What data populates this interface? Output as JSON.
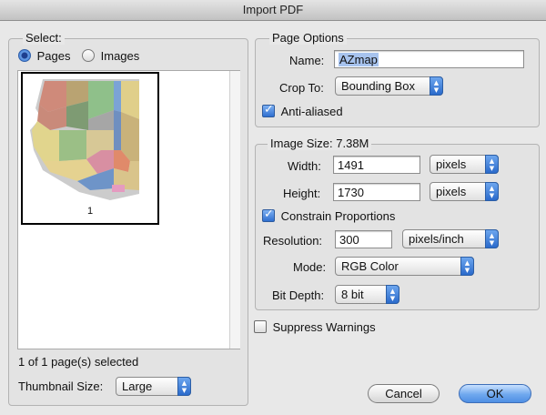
{
  "window": {
    "title": "Import PDF"
  },
  "select": {
    "legend": "Select:",
    "pages_label": "Pages",
    "images_label": "Images",
    "selected": "Pages",
    "thumbnail_page_number": "1",
    "status": "1 of 1 page(s) selected",
    "thumbnail_size_label": "Thumbnail Size:",
    "thumbnail_size_value": "Large"
  },
  "page_options": {
    "legend": "Page Options",
    "name_label": "Name:",
    "name_value": "AZmap",
    "crop_label": "Crop To:",
    "crop_value": "Bounding Box",
    "anti_aliased_label": "Anti-aliased",
    "anti_aliased_checked": true
  },
  "image_size": {
    "legend": "Image Size: 7.38M",
    "width_label": "Width:",
    "width_value": "1491",
    "width_unit": "pixels",
    "height_label": "Height:",
    "height_value": "1730",
    "height_unit": "pixels",
    "constrain_label": "Constrain Proportions",
    "constrain_checked": true,
    "resolution_label": "Resolution:",
    "resolution_value": "300",
    "resolution_unit": "pixels/inch",
    "mode_label": "Mode:",
    "mode_value": "RGB Color",
    "bitdepth_label": "Bit Depth:",
    "bitdepth_value": "8 bit"
  },
  "suppress_warnings_label": "Suppress Warnings",
  "buttons": {
    "cancel": "Cancel",
    "ok": "OK"
  },
  "colors": {
    "accent": "#4f8fe4",
    "selection": "#a7c3ee"
  }
}
